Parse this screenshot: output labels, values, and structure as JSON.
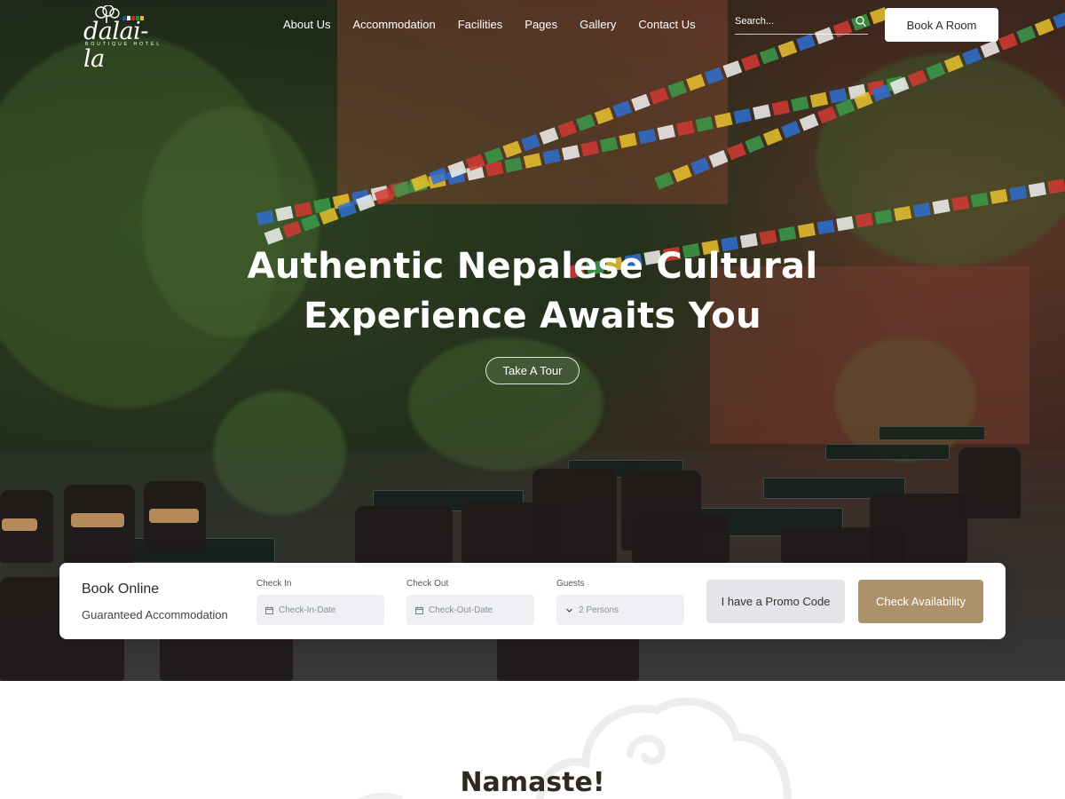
{
  "brand": {
    "name": "dalai-la",
    "tagline": "BOUTIQUE HOTEL",
    "logo_colors": [
      "#1f4fa0",
      "#ffffff",
      "#c0282d",
      "#2e8b3e",
      "#e8c21a"
    ]
  },
  "nav": {
    "items": [
      "About Us",
      "Accommodation",
      "Facilities",
      "Pages",
      "Gallery",
      "Contact Us"
    ]
  },
  "search": {
    "placeholder": "Search...",
    "icon": "search-icon"
  },
  "header": {
    "book_label": "Book A Room"
  },
  "hero": {
    "title_line1": "Authentic Nepalese Cultural",
    "title_line2": "Experience Awaits You",
    "cta_label": "Take A Tour"
  },
  "booking": {
    "title": "Book Online",
    "subtitle": "Guaranteed Accommodation",
    "check_in": {
      "label": "Check In",
      "placeholder": "Check-In-Date",
      "icon": "calendar-icon"
    },
    "check_out": {
      "label": "Check Out",
      "placeholder": "Check-Out-Date",
      "icon": "calendar-icon"
    },
    "guests": {
      "label": "Guests",
      "value": "2 Persons",
      "icon": "chevron-down-icon"
    },
    "promo_label": "I have a Promo Code",
    "check_label": "Check Availability"
  },
  "section": {
    "heading": "Namaste!"
  },
  "colors": {
    "accent": "#ad916a",
    "promo_bg": "#e3e5e8",
    "field_bg": "#eef0f3",
    "prayer_flags": [
      "#2f6fd0",
      "#f2f2f2",
      "#d23a33",
      "#3b9a4a",
      "#e9c230"
    ]
  }
}
